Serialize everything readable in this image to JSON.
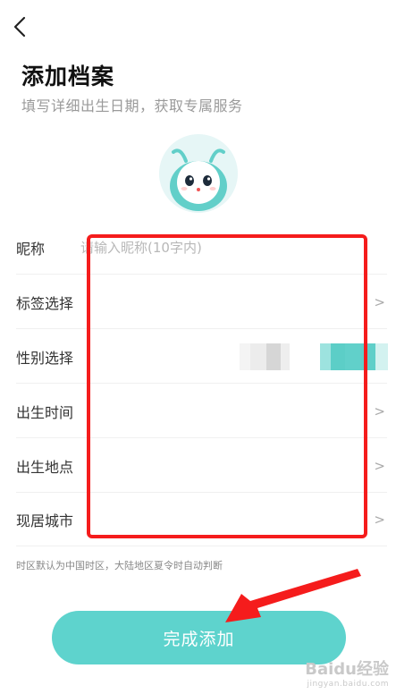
{
  "header": {
    "back_icon": "chevron-left-icon",
    "title": "添加档案",
    "subtitle": "填写详细出生日期，获取专属服务"
  },
  "avatar": {
    "icon": "mascot-avatar"
  },
  "form": {
    "rows": [
      {
        "label": "昵称",
        "placeholder": "请输入昵称(10字内)",
        "value": ""
      },
      {
        "label": "标签选择",
        "chevron": ">"
      },
      {
        "label": "性别选择"
      },
      {
        "label": "出生时间",
        "chevron": ">"
      },
      {
        "label": "出生地点",
        "chevron": ">"
      },
      {
        "label": "现居城市",
        "chevron": ">"
      }
    ],
    "gender_accent_color": "#5ed3cd"
  },
  "note": "时区默认为中国时区，大陆地区夏令时自动判断",
  "submit_label": "完成添加",
  "colors": {
    "accent": "#5ed3cd",
    "highlight": "#f51c1c"
  },
  "watermark": {
    "main": "Baidu经验",
    "sub": "jingyan.baidu.com"
  }
}
